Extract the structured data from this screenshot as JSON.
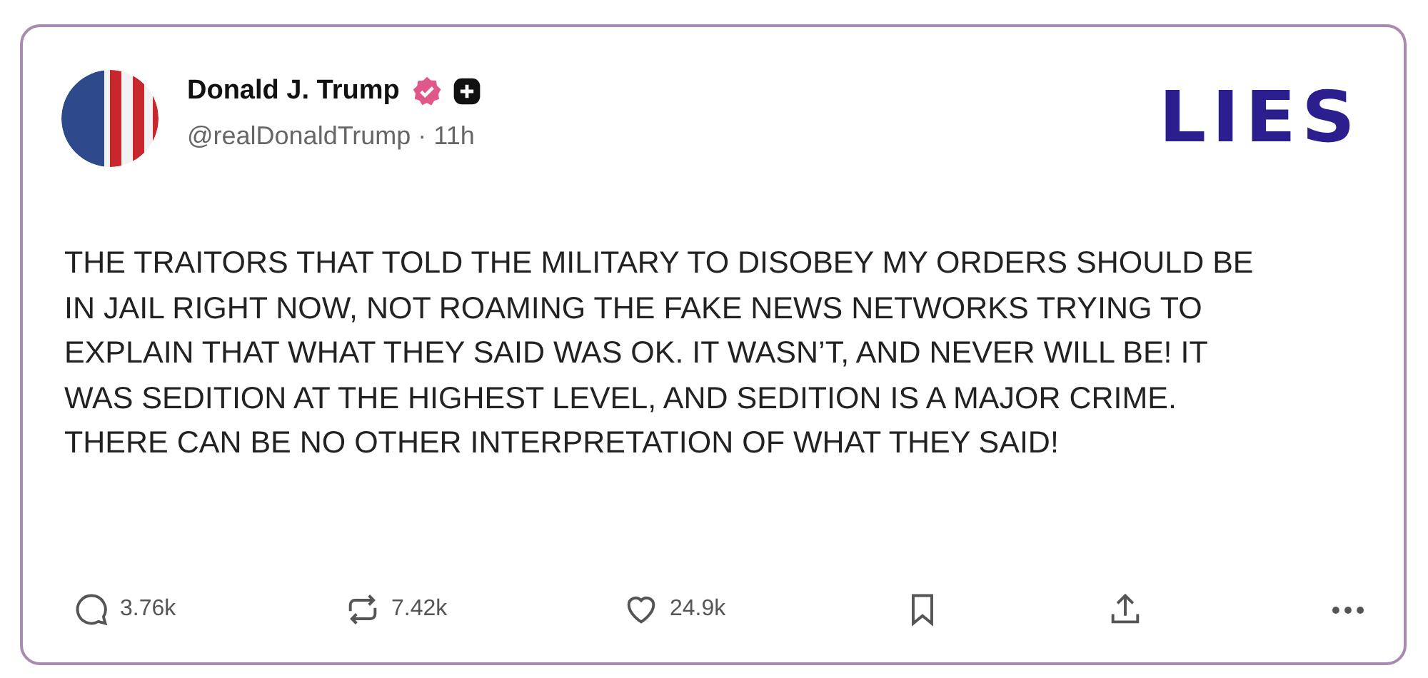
{
  "post": {
    "author": {
      "name": "Donald J. Trump",
      "handle": "@realDonaldTrump · 11h",
      "verified": true
    },
    "stamp": "LIES",
    "body": "THE TRAITORS THAT TOLD THE MILITARY TO DISOBEY MY ORDERS SHOULD BE IN JAIL RIGHT NOW, NOT ROAMING THE FAKE NEWS NETWORKS TRYING TO EXPLAIN THAT WHAT THEY SAID WAS OK. IT WASN’T, AND NEVER WILL BE! IT WAS SEDITION AT THE HIGHEST LEVEL, AND SEDITION IS A MAJOR CRIME. THERE CAN BE NO OTHER INTERPRETATION OF WHAT THEY SAID!",
    "actions": [
      {
        "kind": "reply",
        "count": "3.76k"
      },
      {
        "kind": "repost",
        "count": "7.42k"
      },
      {
        "kind": "like",
        "count": "24.9k"
      },
      {
        "kind": "bookmark"
      },
      {
        "kind": "share"
      },
      {
        "kind": "more"
      }
    ]
  }
}
